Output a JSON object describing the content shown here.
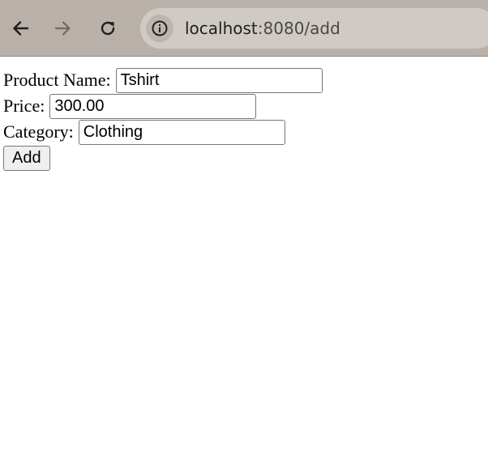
{
  "browser": {
    "url_host": "localhost",
    "url_rest": ":8080/add",
    "icons": {
      "back": "arrow-left-icon",
      "forward": "arrow-right-icon",
      "reload": "reload-icon",
      "site_info": "info-icon"
    },
    "colors": {
      "toolbar": "#b9b1a9",
      "omnibox": "#d0cac4"
    }
  },
  "form": {
    "name_label": "Product Name:",
    "name_value": "Tshirt",
    "price_label": "Price:",
    "price_value": "300.00",
    "category_label": "Category:",
    "category_value": "Clothing",
    "submit_label": "Add"
  }
}
